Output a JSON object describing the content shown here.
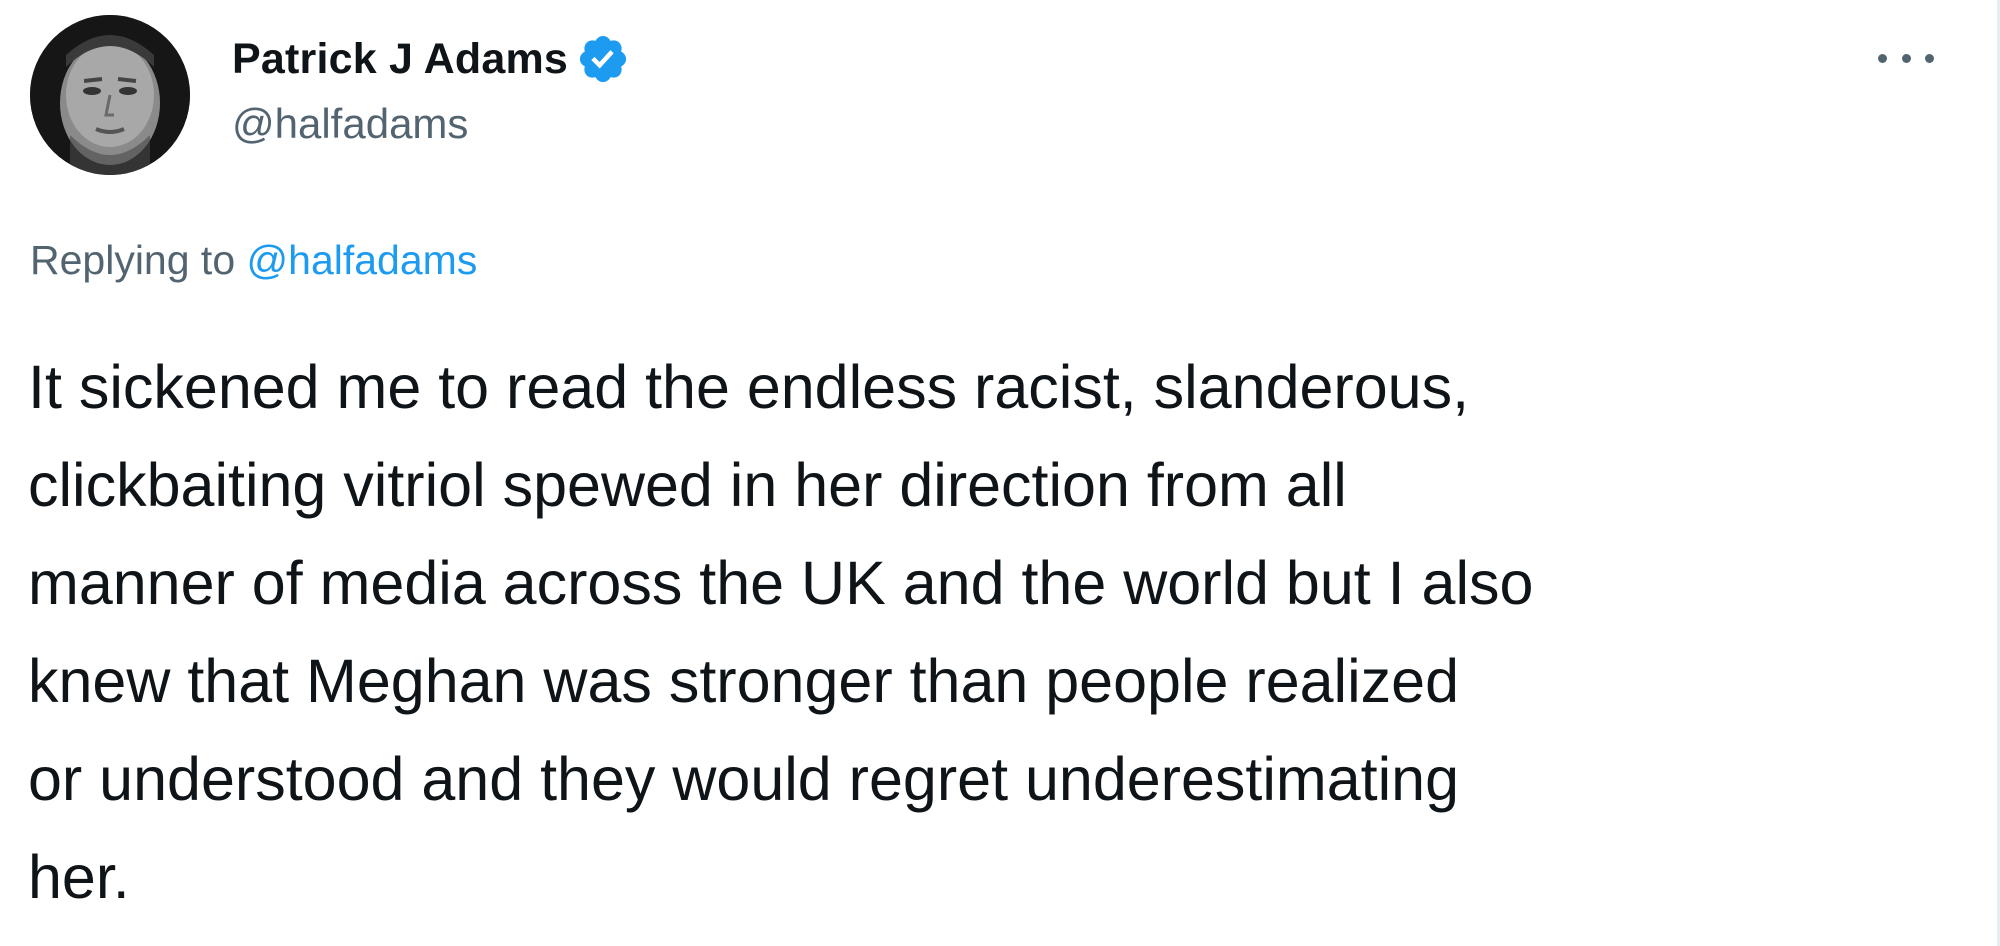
{
  "author": {
    "display_name": "Patrick J Adams",
    "handle": "@halfadams",
    "verified": true,
    "avatar_icon": "profile-photo"
  },
  "reply": {
    "prefix": "Replying to",
    "mention": "@halfadams"
  },
  "tweet": {
    "text": "It sickened me to read the endless racist, slanderous,\nclickbaiting vitriol spewed in her direction from all\nmanner of media across the UK and the world but I also\nknew that Meghan was stronger than people realized\nor understood and they would regret underestimating\nher."
  },
  "icons": {
    "verified": "verified-badge-icon",
    "more": "more-options-icon"
  },
  "colors": {
    "link": "#1d9bf0",
    "secondary_text": "#536471",
    "primary_text": "#0f1419"
  }
}
